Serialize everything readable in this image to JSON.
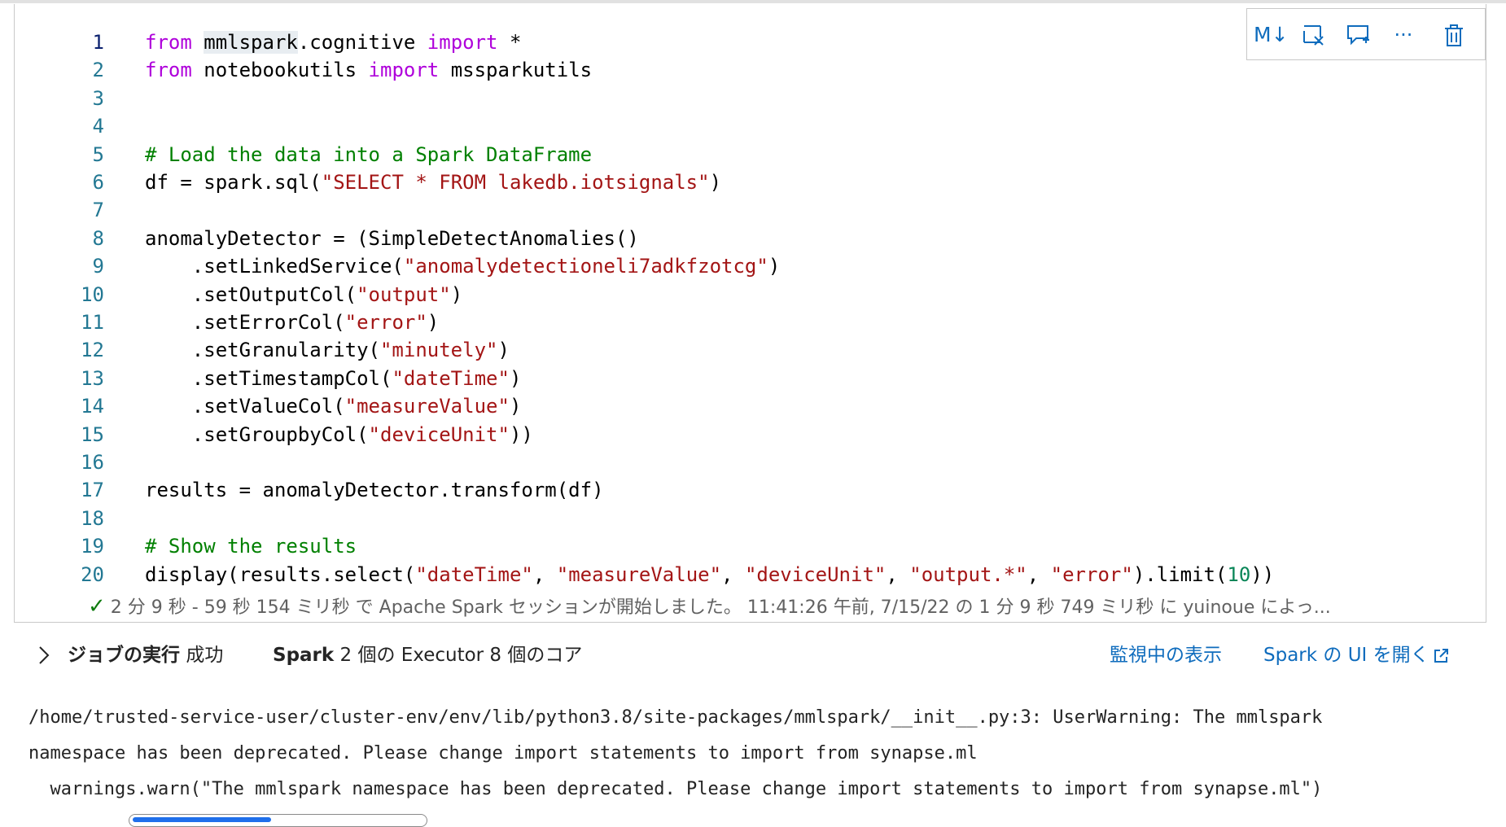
{
  "toolbar": {
    "markdown_label": "M↓",
    "more_label": "···"
  },
  "code": {
    "lines": [
      {
        "n": "1",
        "tokens": [
          {
            "t": "kw",
            "v": "from"
          },
          {
            "t": "p",
            "v": " "
          },
          {
            "t": "hl",
            "v": "mmlspark"
          },
          {
            "t": "p",
            "v": ".cognitive "
          },
          {
            "t": "kw",
            "v": "import"
          },
          {
            "t": "p",
            "v": " *"
          }
        ]
      },
      {
        "n": "2",
        "tokens": [
          {
            "t": "kw",
            "v": "from"
          },
          {
            "t": "p",
            "v": " notebookutils "
          },
          {
            "t": "kw",
            "v": "import"
          },
          {
            "t": "p",
            "v": " mssparkutils"
          }
        ]
      },
      {
        "n": "3",
        "tokens": []
      },
      {
        "n": "4",
        "tokens": []
      },
      {
        "n": "5",
        "tokens": [
          {
            "t": "com",
            "v": "# Load the data into a Spark DataFrame"
          }
        ]
      },
      {
        "n": "6",
        "tokens": [
          {
            "t": "p",
            "v": "df = spark.sql("
          },
          {
            "t": "str",
            "v": "\"SELECT * FROM lakedb.iotsignals\""
          },
          {
            "t": "p",
            "v": ")"
          }
        ]
      },
      {
        "n": "7",
        "tokens": []
      },
      {
        "n": "8",
        "tokens": [
          {
            "t": "p",
            "v": "anomalyDetector = (SimpleDetectAnomalies()"
          }
        ]
      },
      {
        "n": "9",
        "tokens": [
          {
            "t": "p",
            "v": "    .setLinkedService("
          },
          {
            "t": "str",
            "v": "\"anomalydetectioneli7adkfzotcg\""
          },
          {
            "t": "p",
            "v": ")"
          }
        ]
      },
      {
        "n": "10",
        "tokens": [
          {
            "t": "p",
            "v": "    .setOutputCol("
          },
          {
            "t": "str",
            "v": "\"output\""
          },
          {
            "t": "p",
            "v": ")"
          }
        ]
      },
      {
        "n": "11",
        "tokens": [
          {
            "t": "p",
            "v": "    .setErrorCol("
          },
          {
            "t": "str",
            "v": "\"error\""
          },
          {
            "t": "p",
            "v": ")"
          }
        ]
      },
      {
        "n": "12",
        "tokens": [
          {
            "t": "p",
            "v": "    .setGranularity("
          },
          {
            "t": "str",
            "v": "\"minutely\""
          },
          {
            "t": "p",
            "v": ")"
          }
        ]
      },
      {
        "n": "13",
        "tokens": [
          {
            "t": "p",
            "v": "    .setTimestampCol("
          },
          {
            "t": "str",
            "v": "\"dateTime\""
          },
          {
            "t": "p",
            "v": ")"
          }
        ]
      },
      {
        "n": "14",
        "tokens": [
          {
            "t": "p",
            "v": "    .setValueCol("
          },
          {
            "t": "str",
            "v": "\"measureValue\""
          },
          {
            "t": "p",
            "v": ")"
          }
        ]
      },
      {
        "n": "15",
        "tokens": [
          {
            "t": "p",
            "v": "    .setGroupbyCol("
          },
          {
            "t": "str",
            "v": "\"deviceUnit\""
          },
          {
            "t": "p",
            "v": "))"
          }
        ]
      },
      {
        "n": "16",
        "tokens": []
      },
      {
        "n": "17",
        "tokens": [
          {
            "t": "p",
            "v": "results = anomalyDetector.transform(df)"
          }
        ]
      },
      {
        "n": "18",
        "tokens": []
      },
      {
        "n": "19",
        "tokens": [
          {
            "t": "com",
            "v": "# Show the results"
          }
        ]
      },
      {
        "n": "20",
        "tokens": [
          {
            "t": "p",
            "v": "display(results.select("
          },
          {
            "t": "str",
            "v": "\"dateTime\""
          },
          {
            "t": "p",
            "v": ", "
          },
          {
            "t": "str",
            "v": "\"measureValue\""
          },
          {
            "t": "p",
            "v": ", "
          },
          {
            "t": "str",
            "v": "\"deviceUnit\""
          },
          {
            "t": "p",
            "v": ", "
          },
          {
            "t": "str",
            "v": "\"output.*\""
          },
          {
            "t": "p",
            "v": ", "
          },
          {
            "t": "str",
            "v": "\"error\""
          },
          {
            "t": "p",
            "v": ").limit("
          },
          {
            "t": "num",
            "v": "10"
          },
          {
            "t": "p",
            "v": "))"
          }
        ]
      }
    ]
  },
  "status": {
    "check_glyph": "✓",
    "text": "2 分 9 秒 - 59 秒 154 ミリ秒 で Apache Spark セッションが開始しました。 11:41:26 午前, 7/15/22 の 1 分 9 秒 749 ミリ秒 に yuinoue によっ..."
  },
  "job": {
    "title": "ジョブの実行",
    "result": "成功",
    "spark_label": "Spark",
    "spark_detail": "2 個の Executor 8 個のコア",
    "monitor_link": "監視中の表示",
    "spark_ui_link": "Spark の UI を開く"
  },
  "output": {
    "lines": [
      "/home/trusted-service-user/cluster-env/env/lib/python3.8/site-packages/mmlspark/__init__.py:3: UserWarning: The mmlspark",
      "namespace has been deprecated. Please change import statements to import from synapse.ml",
      "  warnings.warn(\"The mmlspark namespace has been deprecated. Please change import statements to import from synapse.ml\")"
    ]
  },
  "colors": {
    "keyword": "#af00db",
    "string": "#a31515",
    "comment": "#008000",
    "number": "#098658",
    "line_number": "#237893",
    "accent": "#0f6cbd",
    "success": "#107c10"
  }
}
